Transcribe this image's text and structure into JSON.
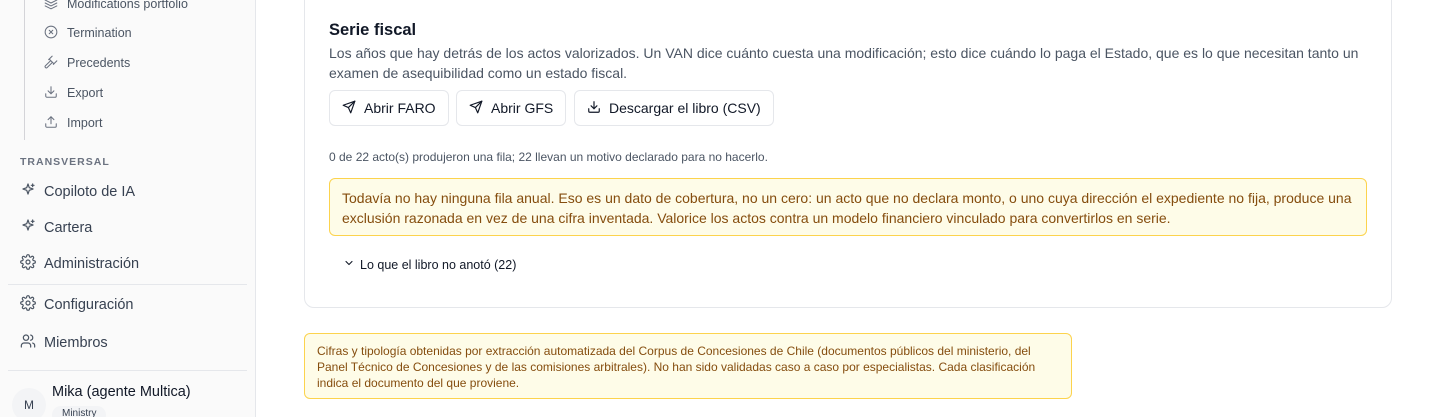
{
  "sidebar": {
    "sub_items": [
      {
        "label": "Modifications portfolio",
        "icon": "layers-icon"
      },
      {
        "label": "Termination",
        "icon": "x-circle-icon"
      },
      {
        "label": "Precedents",
        "icon": "gavel-icon"
      },
      {
        "label": "Export",
        "icon": "download-icon"
      },
      {
        "label": "Import",
        "icon": "upload-icon"
      }
    ],
    "section_label": "TRANSVERSAL",
    "nav_items": [
      {
        "label": "Copiloto de IA",
        "icon": "sparkles-icon"
      },
      {
        "label": "Cartera",
        "icon": "sparkles-icon"
      },
      {
        "label": "Administración",
        "icon": "gear-icon"
      },
      {
        "label": "Configuración",
        "icon": "gear-icon"
      },
      {
        "label": "Miembros",
        "icon": "users-icon"
      }
    ],
    "user": {
      "initial": "M",
      "name": "Mika (agente Multica)",
      "role": "Ministry"
    }
  },
  "main": {
    "title": "Serie fiscal",
    "description": "Los años que hay detrás de los actos valorizados. Un VAN dice cuánto cuesta una modificación; esto dice cuándo lo paga el Estado, que es lo que necesitan tanto un examen de asequibilidad como un estado fiscal.",
    "buttons": {
      "faro": "Abrir FARO",
      "gfs": "Abrir GFS",
      "csv": "Descargar el libro (CSV)"
    },
    "status": "0 de 22 acto(s) produjeron una fila; 22 llevan un motivo declarado para no hacerlo.",
    "warning": "Todavía no hay ninguna fila anual. Eso es un dato de cobertura, no un cero: un acto que no declara monto, o uno cuya dirección el expediente no fija, produce una exclusión razonada en vez de una cifra inventada. Valorice los actos contra un modelo financiero vinculado para convertirlos en serie.",
    "disclosure": "Lo que el libro no anotó (22)",
    "footer_note": "Cifras y tipología obtenidas por extracción automatizada del Corpus de Concesiones de Chile (documentos públicos del ministerio, del Panel Técnico de Concesiones y de las comisiones arbitrales). No han sido validadas caso a caso por especialistas. Cada clasificación indica el documento del que proviene."
  },
  "colors": {
    "warning_bg": "#fefce8",
    "warning_border": "#fcd34d",
    "warning_text": "#854d0e"
  }
}
